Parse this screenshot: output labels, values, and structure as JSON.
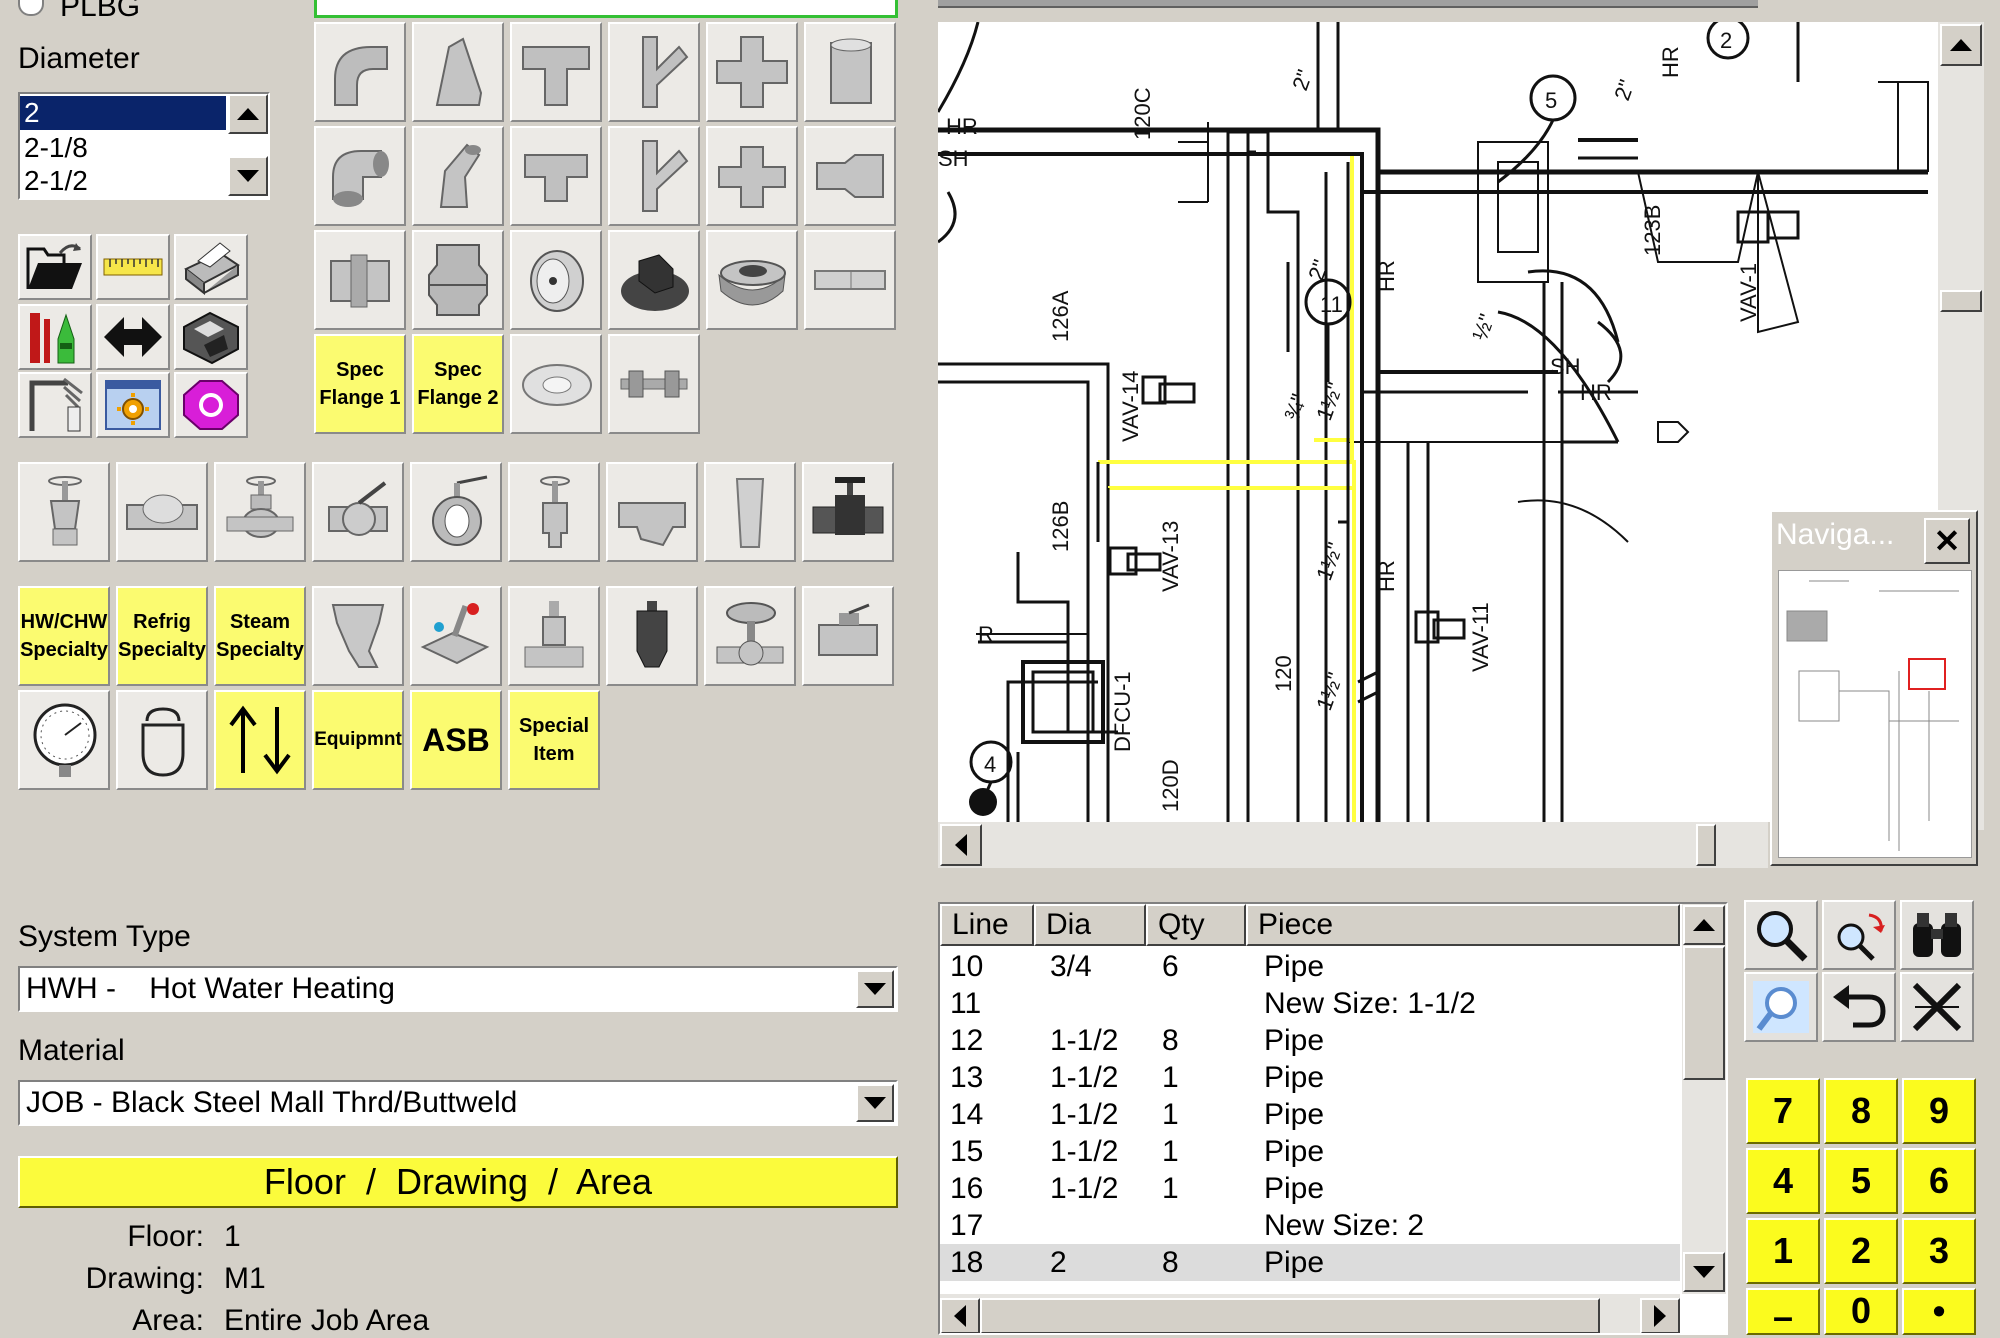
{
  "top_option": {
    "label": "PLBG"
  },
  "diameter": {
    "label": "Diameter",
    "items": [
      "2",
      "2-1/8",
      "2-1/2"
    ],
    "selected": "2"
  },
  "fitting_tiles": {
    "spec_flange_1": "Spec\nFlange 1",
    "spec_flange_2": "Spec\nFlange 2"
  },
  "specialty_tiles": {
    "hw_chw": "HW/CHW\nSpecialty",
    "refrig": "Refrig\nSpecialty",
    "steam": "Steam\nSpecialty",
    "equipment": "Equipmnt",
    "asb": "ASB",
    "special_item": "Special\nItem"
  },
  "system_type": {
    "label": "System Type",
    "value": "HWH -    Hot Water Heating"
  },
  "material": {
    "label": "Material",
    "value": "JOB - Black Steel Mall Thrd/Buttweld"
  },
  "location": {
    "header": "Floor  /  Drawing  /  Area",
    "floor_label": "Floor:",
    "floor_value": "1",
    "drawing_label": "Drawing:",
    "drawing_value": "M1",
    "area_label": "Area:",
    "area_value": "Entire Job Area"
  },
  "navigator": {
    "title": "Naviga...",
    "close": "✕"
  },
  "drawing_labels": {
    "r120c": "120C",
    "r126a": "126A",
    "r126b": "126B",
    "r120": "120",
    "r120d": "120D",
    "r123b": "123B",
    "vav14": "VAV-14",
    "vav13": "VAV-13",
    "vav11": "VAV-11",
    "vav1": "VAV-1",
    "dfcu": "DFCU-1",
    "hr": "HR",
    "sh": "SH",
    "r": "R",
    "c2": "2",
    "c5": "5",
    "c11": "11",
    "c4": "4",
    "s_2a": "2\"",
    "s_2b": "2\"",
    "s_112a": "1½\"",
    "s_112b": "1½\"",
    "s_112c": "1½\"",
    "s_34": "¾\"",
    "s_12": "½\"",
    "s_2c": "2\""
  },
  "takeoff_table": {
    "columns": [
      "Line",
      "Dia",
      "Qty",
      "Piece"
    ],
    "rows": [
      {
        "line": "10",
        "dia": "3/4",
        "qty": "6",
        "piece": "Pipe"
      },
      {
        "line": "11",
        "dia": "",
        "qty": "",
        "piece": "New Size: 1-1/2"
      },
      {
        "line": "12",
        "dia": "1-1/2",
        "qty": "8",
        "piece": "Pipe"
      },
      {
        "line": "13",
        "dia": "1-1/2",
        "qty": "1",
        "piece": "Pipe"
      },
      {
        "line": "14",
        "dia": "1-1/2",
        "qty": "1",
        "piece": "Pipe"
      },
      {
        "line": "15",
        "dia": "1-1/2",
        "qty": "1",
        "piece": "Pipe"
      },
      {
        "line": "16",
        "dia": "1-1/2",
        "qty": "1",
        "piece": "Pipe"
      },
      {
        "line": "17",
        "dia": "",
        "qty": "",
        "piece": "New Size: 2"
      },
      {
        "line": "18",
        "dia": "2",
        "qty": "8",
        "piece": "Pipe"
      }
    ],
    "selected_row": 8
  },
  "keypad": [
    "7",
    "8",
    "9",
    "4",
    "5",
    "6",
    "1",
    "2",
    "3",
    "–",
    "0",
    "•"
  ],
  "colors": {
    "window_bg": "#d4d0c8",
    "highlight_yellow": "#fbfb70",
    "selection_blue": "#0a246a",
    "pipe_yellow": "#ffff40"
  }
}
